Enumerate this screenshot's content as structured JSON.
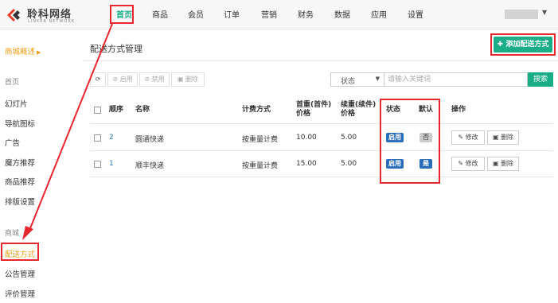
{
  "logo": {
    "name": "聆科网络",
    "tagline": "LINKER NETWORK"
  },
  "nav": [
    "首页",
    "商品",
    "会员",
    "订单",
    "营销",
    "财务",
    "数据",
    "应用",
    "设置"
  ],
  "sidebar": {
    "current": "商城概述",
    "group1": {
      "heading": "首页",
      "items": [
        "幻灯片",
        "导航图标",
        "广告",
        "魔方推荐",
        "商品推荐",
        "排版设置"
      ]
    },
    "group2": {
      "heading": "商城",
      "items": [
        "配送方式",
        "公告管理",
        "评价管理"
      ]
    }
  },
  "page": {
    "title": "配送方式管理",
    "add_label": "添加配送方式"
  },
  "toolbar": {
    "enable": "启用",
    "disable": "禁用",
    "delete": "删除"
  },
  "filter": {
    "status_label": "状态",
    "placeholder": "请输入关键词",
    "search_label": "搜索"
  },
  "table": {
    "headers": {
      "order": "顺序",
      "name": "名称",
      "method": "计费方式",
      "first_weight": "首重(首件)",
      "first_weight2": "价格",
      "next_weight": "续重(续件)",
      "next_weight2": "价格",
      "status": "状态",
      "default": "默认",
      "ops": "操作"
    },
    "rows": [
      {
        "order": "2",
        "name": "圆通快递",
        "method": "按重量计费",
        "first": "10.00",
        "next": "5.00",
        "status": "启用",
        "default": "否",
        "edit": "修改",
        "delete": "删除"
      },
      {
        "order": "1",
        "name": "顺丰快递",
        "method": "按重量计费",
        "first": "15.00",
        "next": "5.00",
        "status": "启用",
        "default": "是",
        "edit": "修改",
        "delete": "删除"
      }
    ]
  },
  "colors": {
    "accent": "#1aae88",
    "badge_blue": "#2a6ebb",
    "highlight_red": "#e8262d",
    "sidebar_current": "#f39c12"
  }
}
